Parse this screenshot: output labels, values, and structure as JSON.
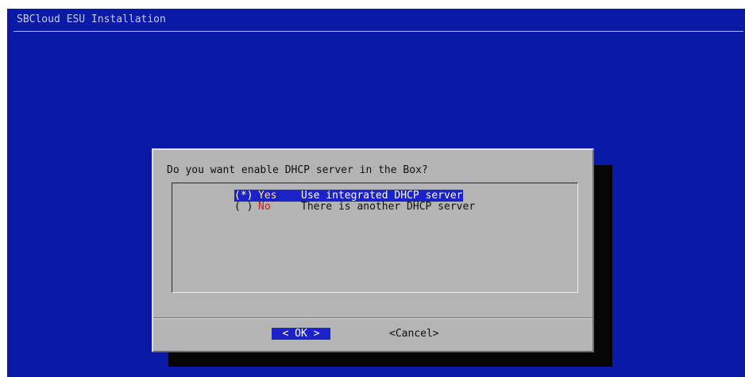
{
  "window": {
    "title": "SBCloud ESU Installation"
  },
  "dialog": {
    "question": "Do you want enable DHCP server in the Box?",
    "options": [
      {
        "radio": "(*)",
        "tag": "Yes",
        "description": "Use integrated DHCP server",
        "selected": true
      },
      {
        "radio": "( )",
        "tag": "No",
        "description": "There is another DHCP server",
        "selected": false
      }
    ],
    "buttons": {
      "ok_label": "< OK >",
      "cancel_label": "<Cancel>"
    }
  },
  "colors": {
    "background": "#0a1aa6",
    "dialog": "#b4b4b4",
    "highlight": "#1a22c8",
    "hotkey": "#c22020"
  }
}
